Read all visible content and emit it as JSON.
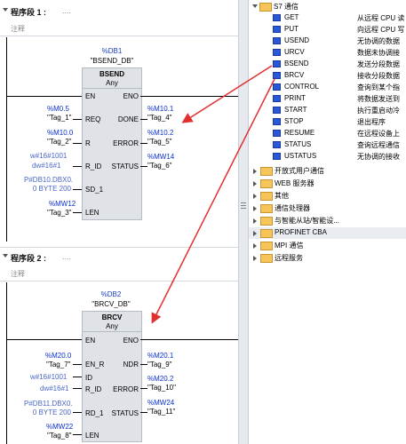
{
  "segment1": {
    "title": "程序段 1 :",
    "title_rest": "....",
    "comment": "注释",
    "db_address": "%DB1",
    "db_name": "\"BSEND_DB\"",
    "block_name": "BSEND",
    "block_sub": "Any",
    "pins_left": [
      "EN",
      "REQ",
      "R",
      "R_ID",
      "SD_1",
      "LEN"
    ],
    "pins_right": [
      "ENO",
      "DONE",
      "ERROR",
      "STATUS"
    ],
    "in_addr": [
      "%M0.5",
      "%M10.0",
      "",
      "",
      "",
      "%MW12"
    ],
    "in_tag": [
      "\"Tag_1\"",
      "\"Tag_2\"",
      "w#16#1001",
      "dw#16#1",
      "P#DB10.DBX0.\n0 BYTE 200",
      "\"Tag_3\""
    ],
    "out_addr": [
      "%M10.1",
      "%M10.2",
      "%MW14"
    ],
    "out_tag": [
      "\"Tag_4\"",
      "\"Tag_5\"",
      "\"Tag_6\""
    ]
  },
  "segment2": {
    "title": "程序段 2 :",
    "title_rest": "....",
    "comment": "注释",
    "db_address": "%DB2",
    "db_name": "\"BRCV_DB\"",
    "block_name": "BRCV",
    "block_sub": "Any",
    "pins_left": [
      "EN",
      "EN_R",
      "ID",
      "R_ID",
      "RD_1",
      "LEN"
    ],
    "pins_right": [
      "ENO",
      "NDR",
      "ERROR",
      "STATUS"
    ],
    "in_addr": [
      "%M20.0",
      "",
      "",
      "",
      "%MW22"
    ],
    "in_tag": [
      "\"Tag_7\"",
      "w#16#1001",
      "dw#16#1",
      "P#DB11.DBX0.\n0 BYTE 200",
      "\"Tag_8\""
    ],
    "out_addr": [
      "%M20.1",
      "%M20.2",
      "%MW24"
    ],
    "out_tag": [
      "\"Tag_9\"",
      "\"Tag_10\"",
      "\"Tag_11\""
    ]
  },
  "tree": {
    "root_label": "S7 通信",
    "instructions": [
      {
        "name": "GET",
        "desc": "从远程 CPU 读"
      },
      {
        "name": "PUT",
        "desc": "向远程 CPU 写"
      },
      {
        "name": "USEND",
        "desc": "无协调的数据"
      },
      {
        "name": "URCV",
        "desc": "数据未协调接"
      },
      {
        "name": "BSEND",
        "desc": "发送分段数据"
      },
      {
        "name": "BRCV",
        "desc": "接收分段数据"
      },
      {
        "name": "CONTROL",
        "desc": "查询到某个指"
      },
      {
        "name": "PRINT",
        "desc": "将数据发送到"
      },
      {
        "name": "START",
        "desc": "执行重启动冷"
      },
      {
        "name": "STOP",
        "desc": "退出程序"
      },
      {
        "name": "RESUME",
        "desc": "在远程设备上"
      },
      {
        "name": "STATUS",
        "desc": "查询远程通信"
      },
      {
        "name": "USTATUS",
        "desc": "无协调的接收"
      }
    ],
    "folders": [
      {
        "label": "开放式用户通信"
      },
      {
        "label": "WEB 服务器"
      },
      {
        "label": "其他"
      },
      {
        "label": "通信处理器"
      },
      {
        "label": "与智能从站/智能设..."
      },
      {
        "label": "PROFINET CBA"
      },
      {
        "label": "MPI 通信"
      },
      {
        "label": "远程服务"
      }
    ]
  },
  "colors": {
    "arrow": "#e03030",
    "instruction_icon": "#2a57d6",
    "folder": "#f5c55a"
  }
}
